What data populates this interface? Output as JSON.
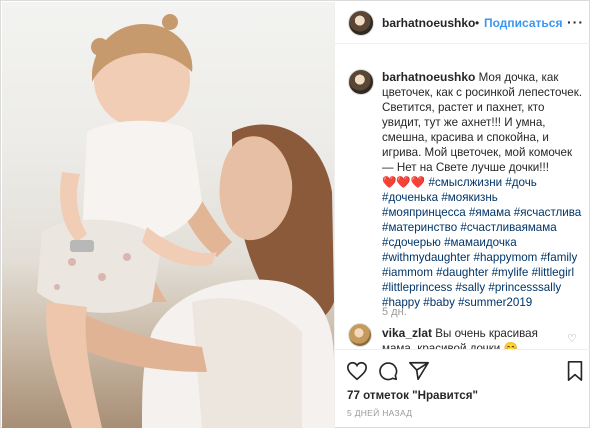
{
  "post": {
    "username": "barhatnoeushko",
    "dot": "•",
    "follow_label": "Подписаться",
    "more_label": "···"
  },
  "caption": {
    "username": "barhatnoeushko",
    "text": "Моя дочка, как цветочек, как с росинкой лепесточек. Светится, растет и пахнет, кто увидит, тут же ахнет!!! И умна, смешна, красива и спокойна, и игрива. Мой цветочек, мой комочек — Нет на Свете лучше дочки!!!",
    "hearts": "❤️❤️❤️",
    "hashtags": [
      "#смыслжизни",
      "#дочь",
      "#доченька",
      "#моякизнь",
      "#мояпринцесса",
      "#ямама",
      "#ясчастлива",
      "#материнство",
      "#счастливаямама",
      "#сдочерью",
      "#мамаидочка",
      "#withmydaughter",
      "#happymom",
      "#family",
      "#iammom",
      "#daughter",
      "#mylife",
      "#littlegirl",
      "#littleprincess",
      "#sally",
      "#princesssally",
      "#happy",
      "#baby",
      "#summer2019"
    ],
    "time": "5 дн."
  },
  "comment": {
    "username": "vika_zlat",
    "text": "Вы очень красивая мама, красивой дочки 😊"
  },
  "actions": {
    "like_icon": "heart-outline-icon",
    "comment_icon": "comment-bubble-icon",
    "share_icon": "paper-plane-icon",
    "save_icon": "bookmark-icon"
  },
  "likes_text": "77 отметок \"Нравится\"",
  "posted_ago": "5 ДНЕЙ НАЗАД",
  "colors": {
    "link": "#003569",
    "follow": "#3897f0",
    "muted": "#999999"
  }
}
